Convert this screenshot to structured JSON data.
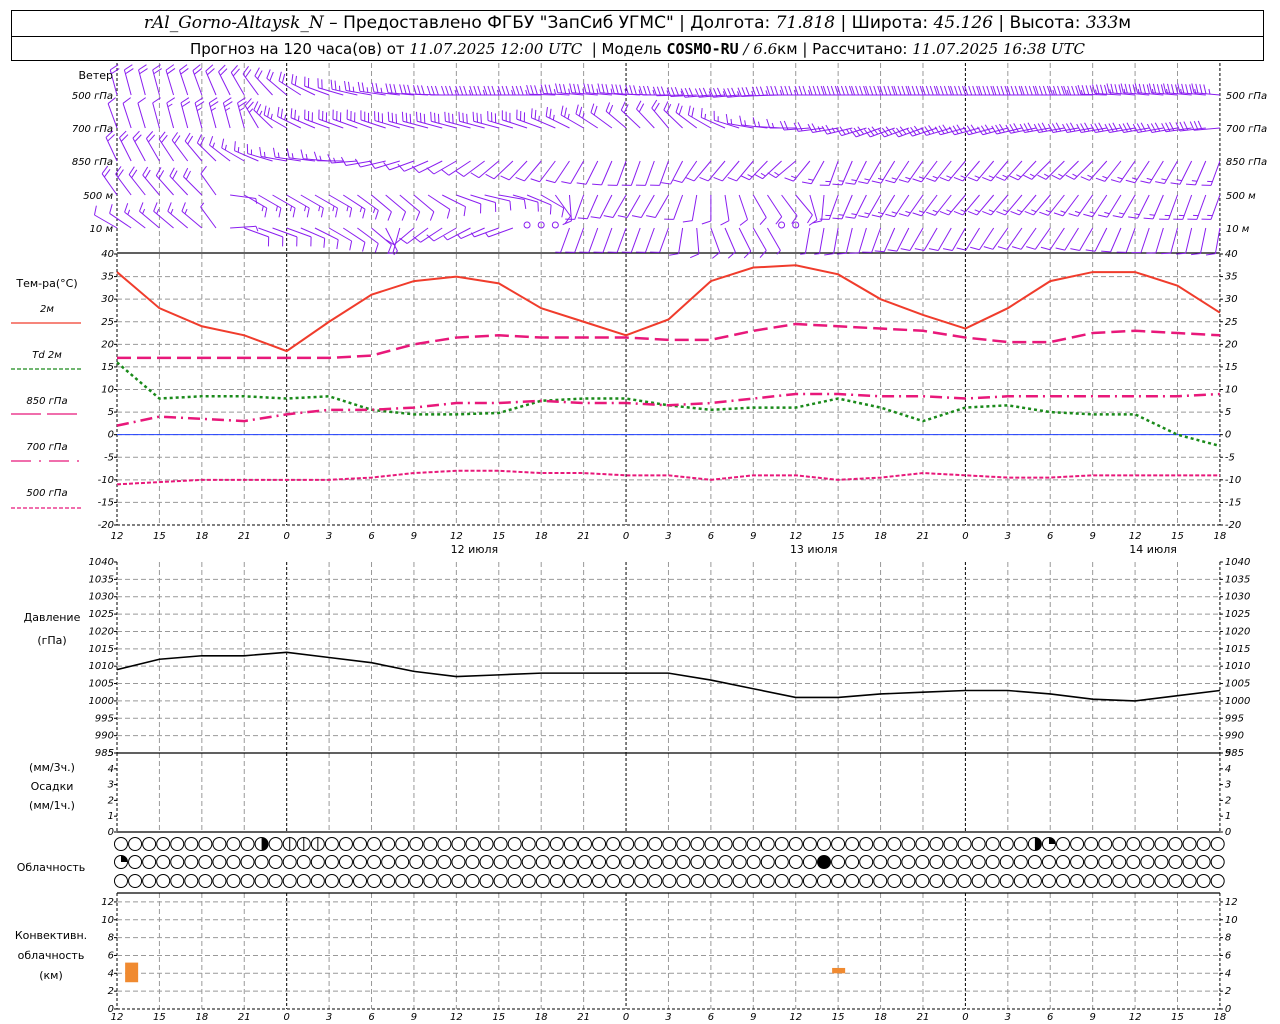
{
  "header": {
    "station": "rAl_Gorno-Altaysk_N",
    "provider": " – Предоставлено ФГБУ \"ЗапСиб УГМС\" | Долгота: ",
    "lon": "71.818",
    "lat_label": " | Широта: ",
    "lat": "45.126",
    "alt_label": " | Высота: ",
    "alt": "333",
    "alt_unit": "м",
    "forecast_label": "Прогноз на 120 часа(ов) от ",
    "forecast_from": "11.07.2025 12:00 UTC",
    "model_label": "  | Модель ",
    "model": "COSMO-RU",
    "model_res": " / 6.6",
    "model_res_unit": "км",
    "calc_label": " | Рассчитано: ",
    "calc_time": "11.07.2025 16:38 UTC"
  },
  "x_axis": {
    "ticks": [
      "12",
      "15",
      "18",
      "21",
      "0",
      "3",
      "6",
      "9",
      "12",
      "15",
      "18",
      "21",
      "0",
      "3",
      "6",
      "9",
      "12",
      "15",
      "18",
      "21",
      "0",
      "3",
      "6",
      "9",
      "12",
      "15",
      "18"
    ],
    "dates": [
      "12 июля",
      "13 июля",
      "14 июля"
    ]
  },
  "wind": {
    "title": "Ветер",
    "color": "#8a1ef0",
    "levels": [
      {
        "label": "500 гПа",
        "dir": [
          345,
          345,
          340,
          330,
          310,
          290,
          280,
          275,
          270,
          270,
          270,
          275,
          275,
          270,
          265,
          265,
          270,
          270,
          270,
          270,
          270,
          270,
          270,
          270,
          275,
          275,
          275
        ],
        "speed": [
          10,
          10,
          11,
          10,
          9,
          10,
          12,
          14,
          16,
          17,
          18,
          18,
          18,
          17,
          16,
          17,
          18,
          19,
          20,
          20,
          20,
          21,
          21,
          22,
          22,
          22,
          22
        ]
      },
      {
        "label": "700 гПа",
        "dir": [
          340,
          345,
          345,
          345,
          300,
          290,
          290,
          285,
          285,
          285,
          290,
          300,
          310,
          320,
          300,
          280,
          270,
          260,
          250,
          250,
          255,
          255,
          260,
          260,
          260,
          260,
          265
        ],
        "speed": [
          5,
          6,
          12,
          12,
          13,
          14,
          14,
          15,
          15,
          15,
          14,
          12,
          10,
          10,
          9,
          8,
          8,
          12,
          14,
          14,
          15,
          15,
          15,
          16,
          16,
          16,
          15
        ]
      },
      {
        "label": "850 гПа",
        "dir": [
          335,
          330,
          320,
          300,
          280,
          275,
          260,
          250,
          240,
          230,
          220,
          210,
          200,
          200,
          220,
          220,
          230,
          200,
          210,
          215,
          220,
          220,
          225,
          225,
          215,
          210,
          200
        ],
        "speed": [
          10,
          10,
          10,
          8,
          8,
          7,
          6,
          6,
          6,
          6,
          6,
          5,
          5,
          5,
          6,
          6,
          7,
          8,
          8,
          8,
          8,
          8,
          8,
          8,
          8,
          8,
          8
        ]
      },
      {
        "label": "500 м",
        "dir": [
          325,
          320,
          315,
          120,
          120,
          120,
          130,
          130,
          110,
          100,
          120,
          200,
          210,
          210,
          180,
          150,
          140,
          200,
          210,
          215,
          220,
          220,
          220,
          215,
          210,
          200,
          200
        ],
        "speed": [
          10,
          10,
          10,
          8,
          7,
          7,
          6,
          6,
          6,
          6,
          5,
          5,
          6,
          6,
          6,
          5,
          5,
          7,
          7,
          7,
          7,
          7,
          8,
          8,
          8,
          8,
          7
        ]
      },
      {
        "label": "10  м",
        "dir": [
          300,
          310,
          310,
          110,
          110,
          120,
          130,
          230,
          240,
          250,
          0,
          200,
          200,
          200,
          160,
          150,
          0,
          190,
          200,
          210,
          210,
          215,
          215,
          210,
          200,
          195,
          190
        ],
        "speed": [
          5,
          7,
          7,
          6,
          5,
          5,
          5,
          4,
          4,
          3,
          0,
          4,
          5,
          5,
          4,
          4,
          0,
          5,
          5,
          6,
          6,
          6,
          6,
          6,
          6,
          5,
          5
        ]
      }
    ]
  },
  "chart_data": [
    {
      "type": "line",
      "title": "Тем-ра(°C)",
      "ylim": [
        -20,
        40
      ],
      "yticks": [
        "40",
        "35",
        "30",
        "25",
        "20",
        "15",
        "10",
        "5",
        "0",
        "-5",
        "-10",
        "-15",
        "-20"
      ],
      "grid": true,
      "x": "x_axis.ticks",
      "series": [
        {
          "name": "2м",
          "color": "#f03c2c",
          "style": "solid",
          "values": [
            36,
            28,
            24,
            22,
            18.5,
            25,
            31,
            34,
            35,
            33.5,
            28,
            25,
            22,
            25.5,
            34,
            37,
            37.5,
            35.5,
            30,
            26.5,
            23.5,
            28,
            34,
            36,
            36,
            33,
            27
          ]
        },
        {
          "name": "Td  2м",
          "color": "#1a8a1a",
          "style": "dotted",
          "values": [
            16,
            8,
            8.5,
            8.5,
            8,
            8.5,
            5.5,
            4.5,
            4.5,
            4.8,
            7.5,
            8,
            8,
            6.5,
            5.5,
            6,
            6,
            8,
            6,
            3,
            6,
            6.5,
            5,
            4.5,
            4.5,
            0,
            -2.5
          ]
        },
        {
          "name": "850 гПа",
          "color": "#e8187a",
          "style": "longdash",
          "values": [
            17,
            17,
            17,
            17,
            17,
            17,
            17.5,
            20,
            21.5,
            22,
            21.5,
            21.5,
            21.5,
            21,
            21,
            23,
            24.5,
            24,
            23.5,
            23,
            21.5,
            20.5,
            20.5,
            22.5,
            23,
            22.5,
            22
          ]
        },
        {
          "name": "700 гПа",
          "color": "#e8187a",
          "style": "dashdot",
          "values": [
            2,
            4,
            3.5,
            3,
            4.5,
            5.5,
            5.5,
            6,
            7,
            7,
            7.5,
            7,
            7,
            6.5,
            7,
            8,
            9,
            9,
            8.5,
            8.5,
            8,
            8.5,
            8.5,
            8.5,
            8.5,
            8.5,
            9
          ]
        },
        {
          "name": "500 гПа",
          "color": "#e8187a",
          "style": "dashed",
          "values": [
            -11,
            -10.5,
            -10,
            -10,
            -10,
            -10,
            -9.5,
            -8.5,
            -8,
            -8,
            -8.5,
            -8.5,
            -9,
            -9,
            -10,
            -9,
            -9,
            -10,
            -9.5,
            -8.5,
            -9,
            -9.5,
            -9.5,
            -9,
            -9,
            -9,
            -9
          ]
        }
      ],
      "zero_line_color": "#2040ff"
    },
    {
      "type": "line",
      "title": "Давление",
      "unit": "(гПа)",
      "ylim": [
        985,
        1040
      ],
      "yticks": [
        "1040",
        "1035",
        "1030",
        "1025",
        "1020",
        "1015",
        "1010",
        "1005",
        "1000",
        "995",
        "990",
        "985"
      ],
      "grid": true,
      "series": [
        {
          "color": "#000000",
          "values": [
            1009,
            1012,
            1013,
            1013,
            1014,
            1012.5,
            1011,
            1008.5,
            1007,
            1007.5,
            1008,
            1008,
            1008,
            1008,
            1006,
            1003.5,
            1001,
            1001,
            1002,
            1002.5,
            1003,
            1003,
            1002,
            1000.5,
            1000,
            1001.5,
            1003
          ]
        }
      ]
    },
    {
      "type": "bar",
      "title": "Осадки",
      "unit_top": "(мм/3ч.)",
      "unit_bottom": "(мм/1ч.)",
      "ylim": [
        0,
        5
      ],
      "yticks": [
        "5",
        "4",
        "3",
        "2",
        "1",
        "0"
      ],
      "values": []
    },
    {
      "type": "table",
      "title": "Облачность",
      "rows": 3,
      "hours": 79,
      "nonclear": [
        {
          "row": 0,
          "time": "11.07 22:00",
          "cover": 0.5
        },
        {
          "row": 0,
          "time": "12.07 00:00",
          "cover": 0.125
        },
        {
          "row": 0,
          "time": "12.07 01:00",
          "cover": 0.125
        },
        {
          "row": 0,
          "time": "12.07 02:00",
          "cover": 0.125
        },
        {
          "row": 0,
          "time": "14.07 05:00",
          "cover": 0.5
        },
        {
          "row": 0,
          "time": "14.07 06:00",
          "cover": 0.25
        },
        {
          "row": 1,
          "time": "11.07 12:00",
          "cover": 0.25
        },
        {
          "row": 1,
          "time": "13.07 14:00",
          "cover": 1
        }
      ]
    },
    {
      "type": "bar",
      "title": "Конвективн.",
      "title2": "облачность",
      "unit": "(км)",
      "ylim": [
        0,
        13
      ],
      "yticks": [
        "12",
        "10",
        "8",
        "6",
        "4",
        "2",
        "0"
      ],
      "color": "#f08a30",
      "bars": [
        {
          "time": "11.07 13:00",
          "base": 3,
          "top": 5.2
        },
        {
          "time": "13.07 15:00",
          "base": 4,
          "top": 4.6
        }
      ]
    }
  ]
}
